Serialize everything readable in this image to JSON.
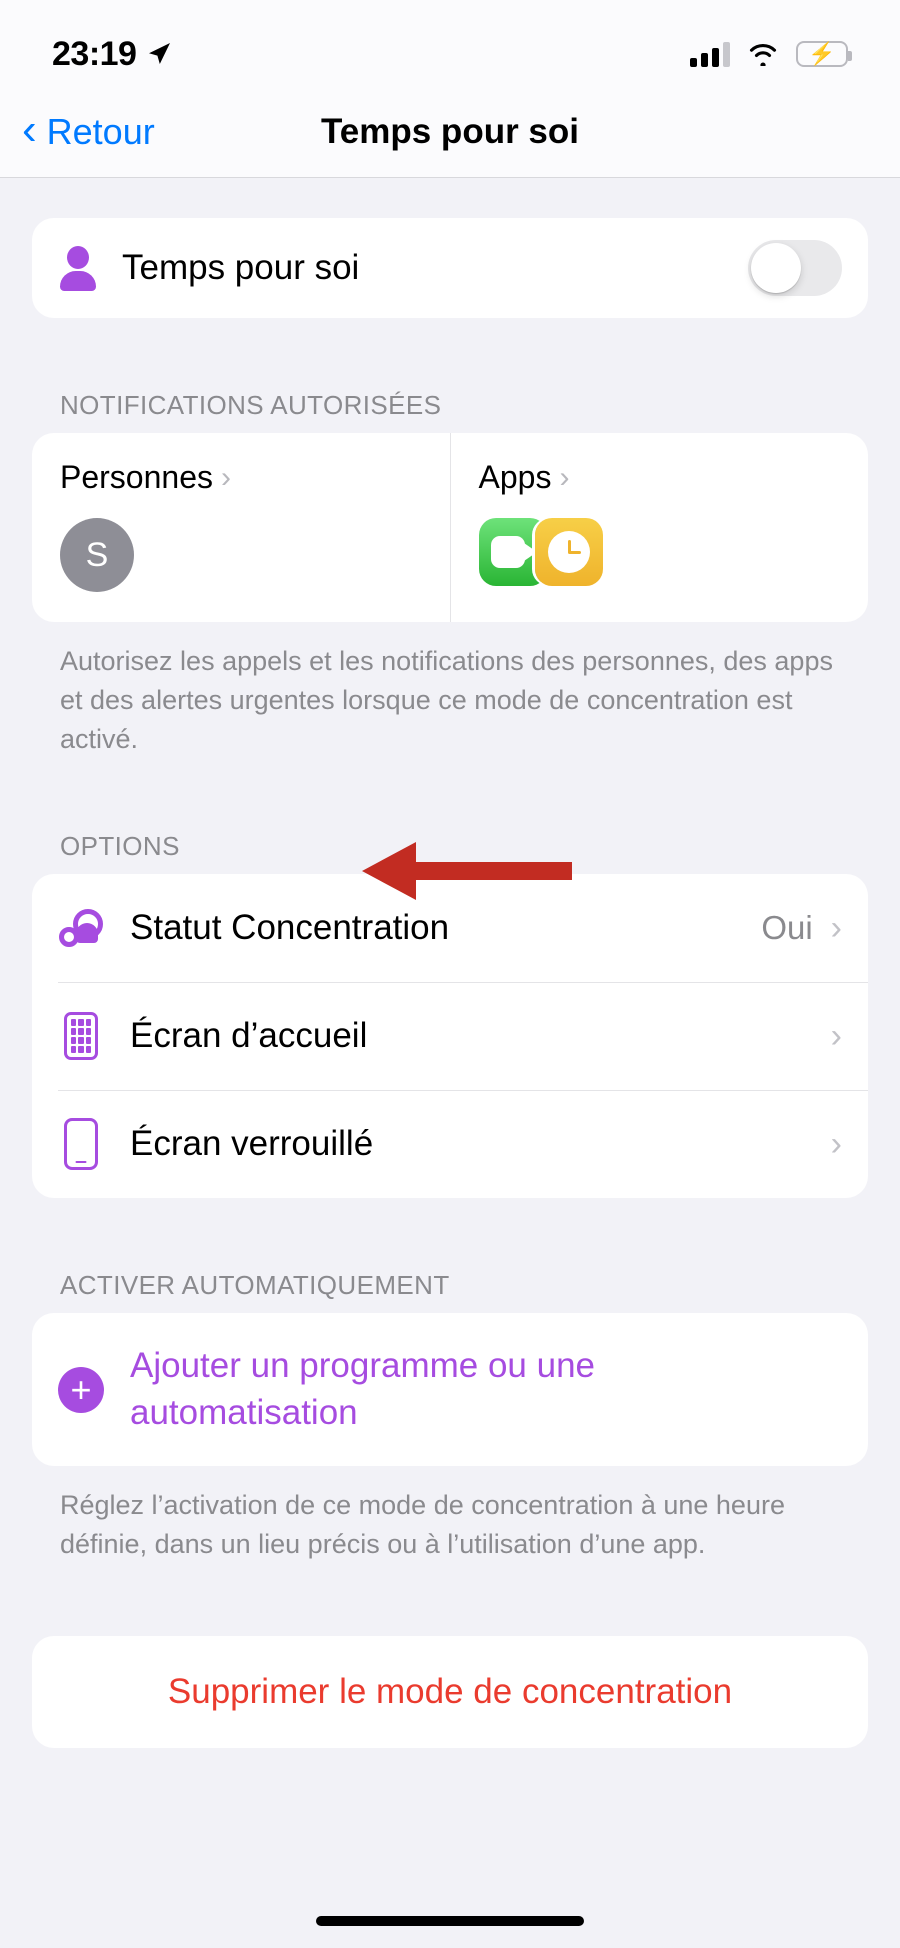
{
  "status_bar": {
    "time": "23:19",
    "location_icon": "location-arrow-icon",
    "signal_icon": "cellular-signal-icon",
    "signal_bars_filled": 3,
    "signal_bars_total": 4,
    "wifi_icon": "wifi-icon",
    "battery_icon": "battery-charging-icon",
    "battery_color": "#3ad749"
  },
  "nav": {
    "back_label": "Retour",
    "back_chevron": "‹",
    "title": "Temps pour soi",
    "tint_color": "#007aff"
  },
  "focus_toggle": {
    "icon": "person-icon",
    "label": "Temps pour soi",
    "enabled": false
  },
  "notifications": {
    "header": "NOTIFICATIONS AUTORISÉES",
    "people": {
      "label": "Personnes",
      "chevron": "›",
      "avatar_initial": "S",
      "avatar_color": "#8e8e96"
    },
    "apps": {
      "label": "Apps",
      "chevron": "›",
      "icons": [
        "facetime-app-icon",
        "clock-app-icon"
      ]
    },
    "footer": "Autorisez les appels et les notifications des personnes, des apps et des alertes urgentes lorsque ce mode de concentration est activé."
  },
  "options": {
    "header": "OPTIONS",
    "rows": [
      {
        "icon": "focus-status-icon",
        "label": "Statut Concentration",
        "value": "Oui",
        "chevron": "›"
      },
      {
        "icon": "home-screen-grid-icon",
        "label": "Écran d’accueil",
        "value": "",
        "chevron": "›"
      },
      {
        "icon": "lock-screen-phone-icon",
        "label": "Écran verrouillé",
        "value": "",
        "chevron": "›"
      }
    ]
  },
  "auto_activate": {
    "header": "ACTIVER AUTOMATIQUEMENT",
    "add_icon": "plus-circle-icon",
    "add_label": "Ajouter un programme ou une automatisation",
    "accent_color": "#a64ce0",
    "footer": "Réglez l’activation de ce mode de concentration à une heure définie, dans un lieu précis ou à l’utilisation d’une app."
  },
  "delete": {
    "label": "Supprimer le mode de concentration",
    "color": "#ea3b2e"
  },
  "annotation": {
    "type": "arrow",
    "color": "#c22c22",
    "points_to": "Écran d’accueil"
  }
}
